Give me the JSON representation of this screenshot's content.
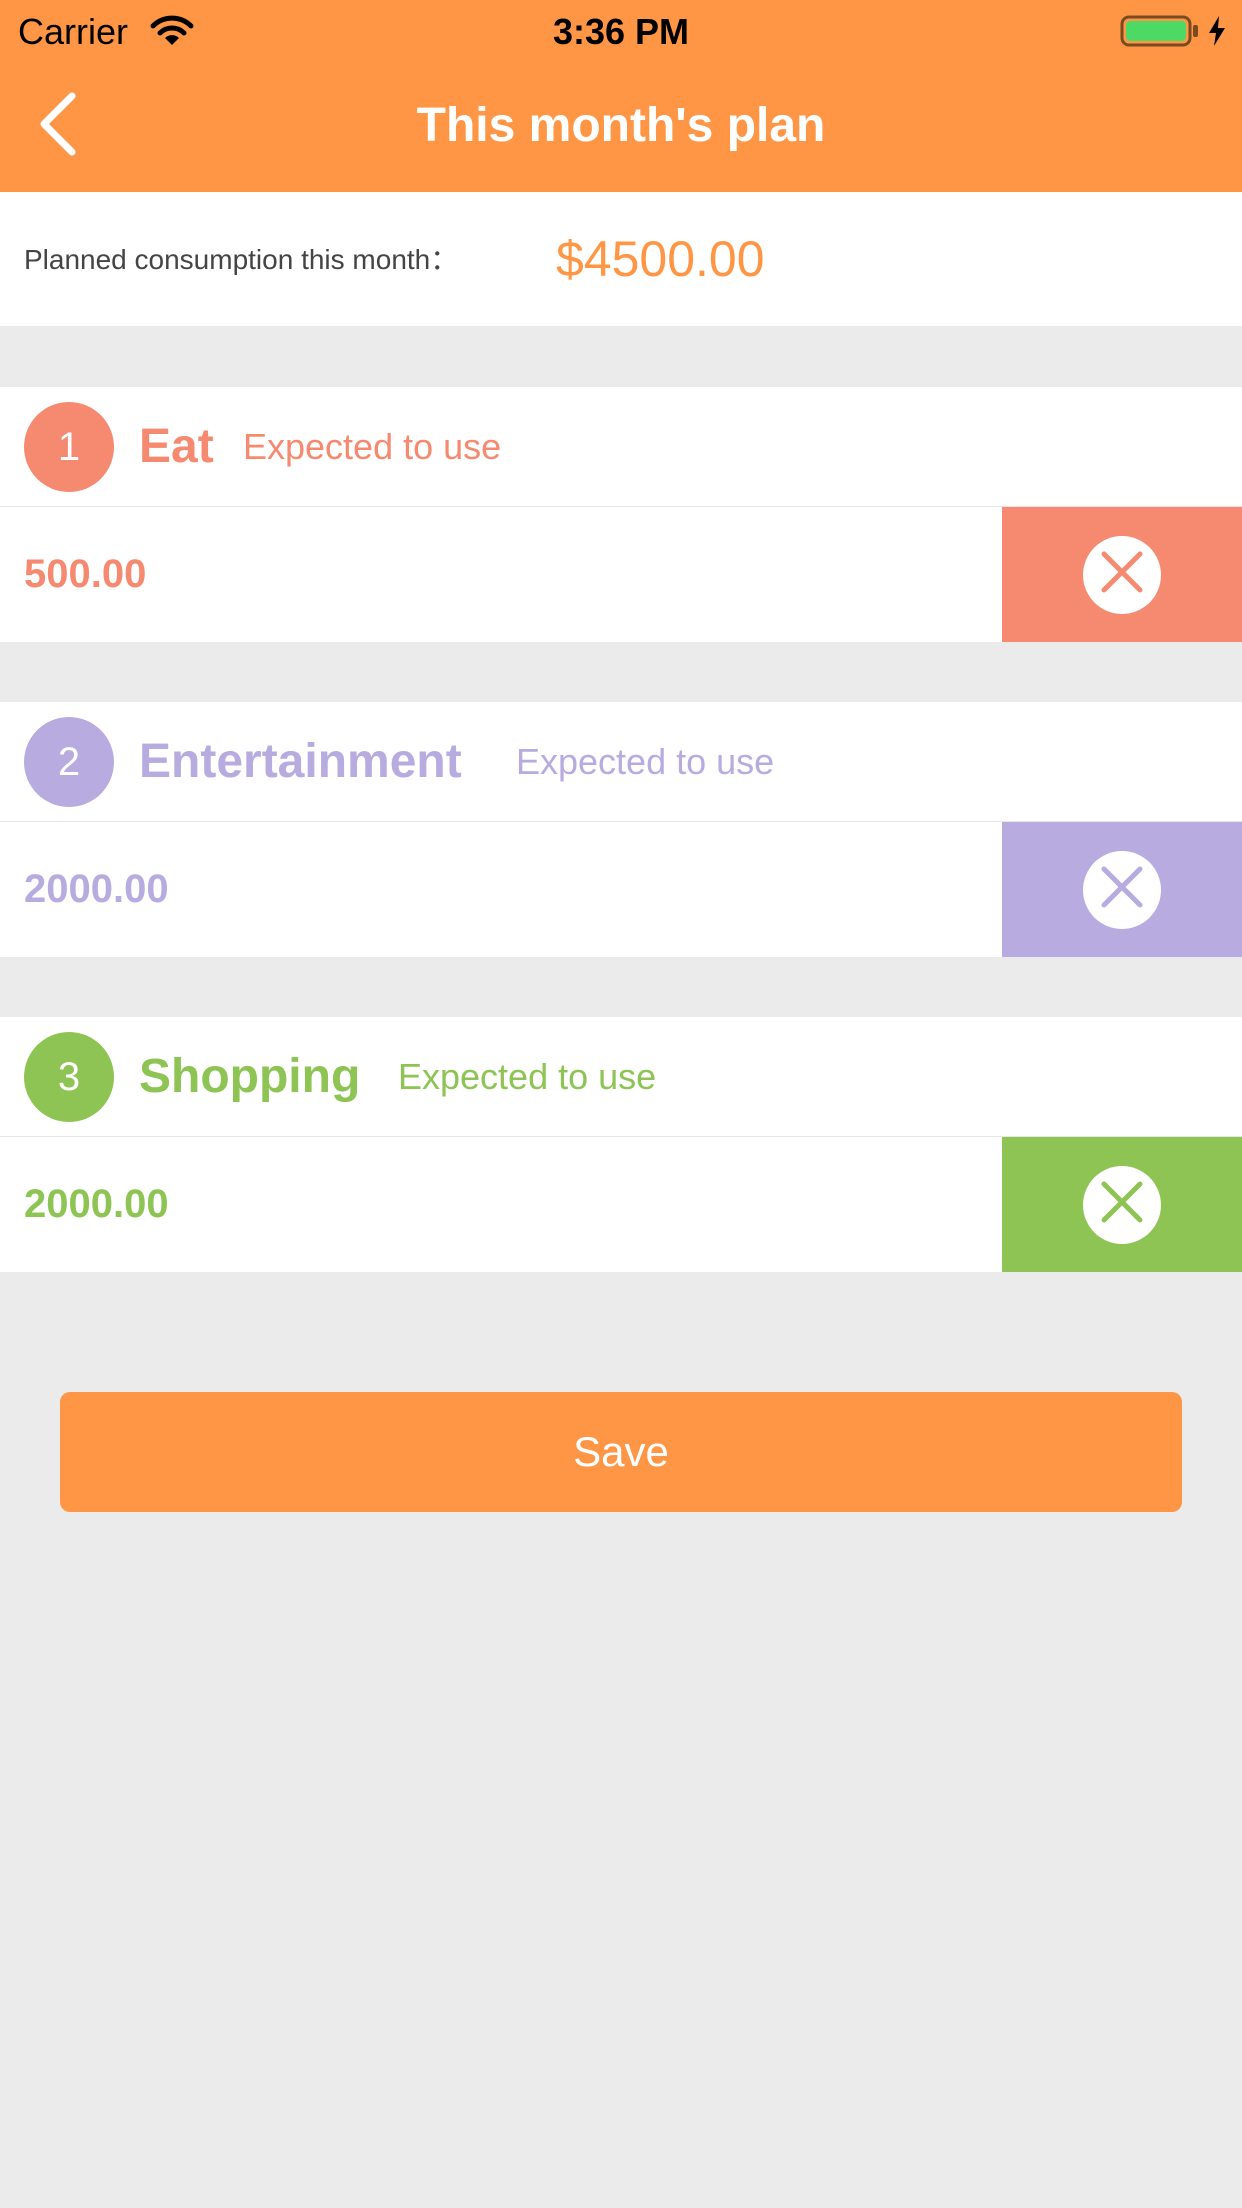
{
  "status_bar": {
    "carrier": "Carrier",
    "time": "3:36 PM",
    "wifi_icon": "wifi-icon",
    "battery_icon": "battery-icon",
    "charging_icon": "charging-bolt-icon"
  },
  "nav": {
    "title": "This month's plan",
    "back_icon": "chevron-left-icon"
  },
  "planned": {
    "label": "Planned consumption this month：",
    "amount": "$4500.00"
  },
  "categories": [
    {
      "index": "1",
      "name": "Eat",
      "expected": "Expected to use",
      "amount": "500.00",
      "color": "#f58a70",
      "delete_icon": "close-icon"
    },
    {
      "index": "2",
      "name": "Entertainment",
      "expected": "Expected to use",
      "amount": "2000.00",
      "color": "#b7abdf",
      "delete_icon": "close-icon"
    },
    {
      "index": "3",
      "name": "Shopping",
      "expected": "Expected to use",
      "amount": "2000.00",
      "color": "#8dc454",
      "delete_icon": "close-icon"
    }
  ],
  "save_label": "Save",
  "colors": {
    "accent": "#ff9645",
    "background": "#ebebeb"
  }
}
